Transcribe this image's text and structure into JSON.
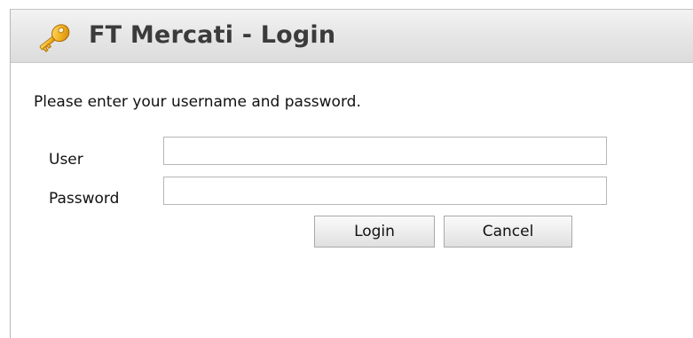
{
  "dialog": {
    "title": "FT Mercati - Login",
    "icon": "key-icon",
    "prompt": "Please enter your username and password."
  },
  "form": {
    "user_label": "User",
    "user_value": "",
    "password_label": "Password",
    "password_value": ""
  },
  "buttons": {
    "login_label": "Login",
    "cancel_label": "Cancel"
  },
  "colors": {
    "title_text": "#3b3b3b",
    "titlebar_bg": "#e6e6e6",
    "key_gold": "#e8a317"
  }
}
